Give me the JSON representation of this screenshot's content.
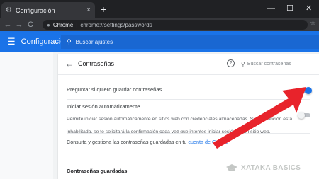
{
  "tab": {
    "title": "Configuración",
    "close": "×",
    "new_tab": "+"
  },
  "window": {
    "minimize": "—",
    "maximize": "☐",
    "close": "✕"
  },
  "toolbar": {
    "back": "←",
    "forward": "→",
    "reload": "C",
    "site_chip": "Chrome",
    "separator": "|",
    "url": "chrome://settings/passwords",
    "bookmark": "☆"
  },
  "header": {
    "title": "Configuración",
    "search_placeholder": "Buscar ajustes"
  },
  "passwords": {
    "back": "←",
    "title": "Contraseñas",
    "help": "?",
    "search_placeholder": "Buscar contraseñas",
    "offer_save_label": "Preguntar si quiero guardar contraseñas",
    "offer_save_on": true,
    "autosignin_label": "Iniciar sesión automáticamente",
    "autosignin_desc": "Permite iniciar sesión automáticamente en sitios web con credenciales almacenadas. Si esta función está inhabilitada, se te solicitará la confirmación cada vez que intentes iniciar sesión en un sitio web.",
    "autosignin_on": false,
    "manage_text": "Consulta y gestiona las contraseñas guardadas en tu ",
    "manage_link": "cuenta de Google",
    "saved_heading": "Contraseñas guardadas"
  },
  "watermark": {
    "text": "XATAKA BASICS"
  },
  "colors": {
    "accent": "#1a73e8",
    "arrow": "#e8232b",
    "header": "#1a73e8"
  }
}
